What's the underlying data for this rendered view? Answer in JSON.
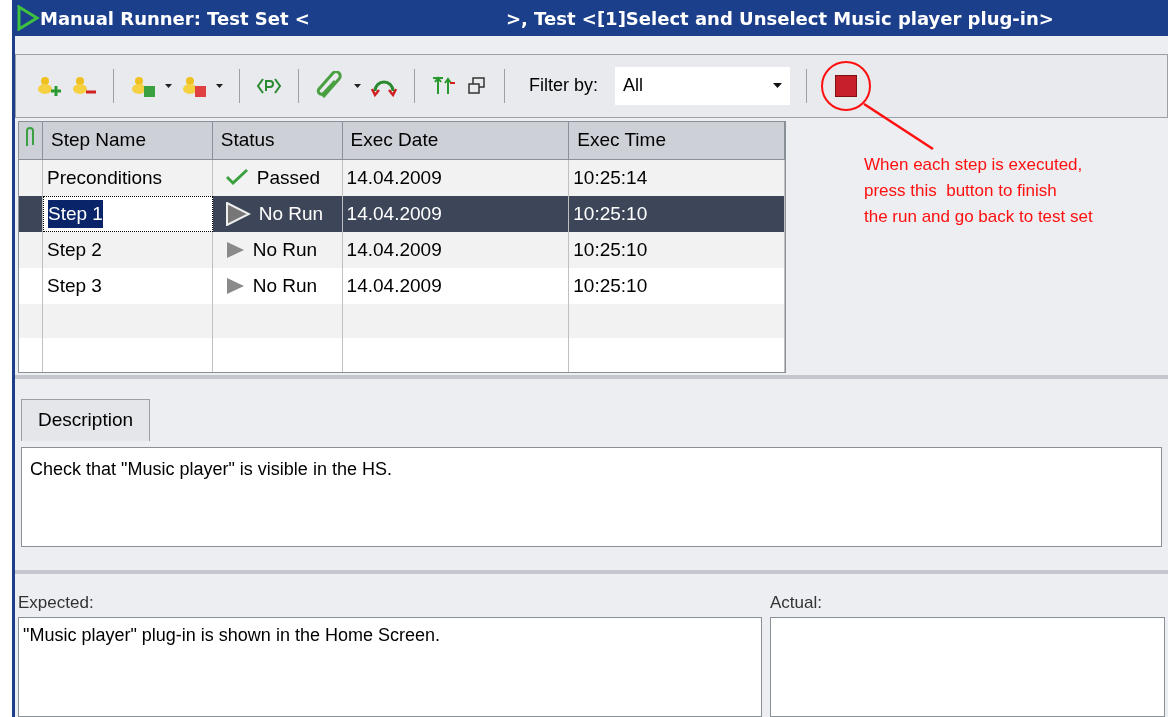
{
  "window": {
    "title_start": "Manual Runner: Test Set <",
    "title_end": ">, Test <[1]Select and Unselect Music player plug-in>"
  },
  "toolbar": {
    "filter_label": "Filter by:",
    "filter_value": "All"
  },
  "table": {
    "columns": [
      "Step Name",
      "Status",
      "Exec Date",
      "Exec Time"
    ],
    "rows": [
      {
        "name": "Preconditions",
        "kind": "passed",
        "status": "Passed",
        "date": "14.04.2009",
        "time": "10:25:14",
        "selected": false
      },
      {
        "name": "Step 1",
        "kind": "no_run",
        "status": "No Run",
        "date": "14.04.2009",
        "time": "10:25:10",
        "selected": true
      },
      {
        "name": "Step 2",
        "kind": "no_run",
        "status": "No Run",
        "date": "14.04.2009",
        "time": "10:25:10",
        "selected": false
      },
      {
        "name": "Step 3",
        "kind": "no_run",
        "status": "No Run",
        "date": "14.04.2009",
        "time": "10:25:10",
        "selected": false
      }
    ]
  },
  "annotation": {
    "lines": [
      "When each step is executed,",
      "press this  button to finish",
      "the run and go back to test set"
    ]
  },
  "description": {
    "tab": "Description",
    "text": "Check that \"Music player\" is visible in the HS."
  },
  "expected": {
    "label": "Expected:",
    "text": "\"Music player\" plug-in is shown in the Home Screen."
  },
  "actual": {
    "label": "Actual:"
  }
}
